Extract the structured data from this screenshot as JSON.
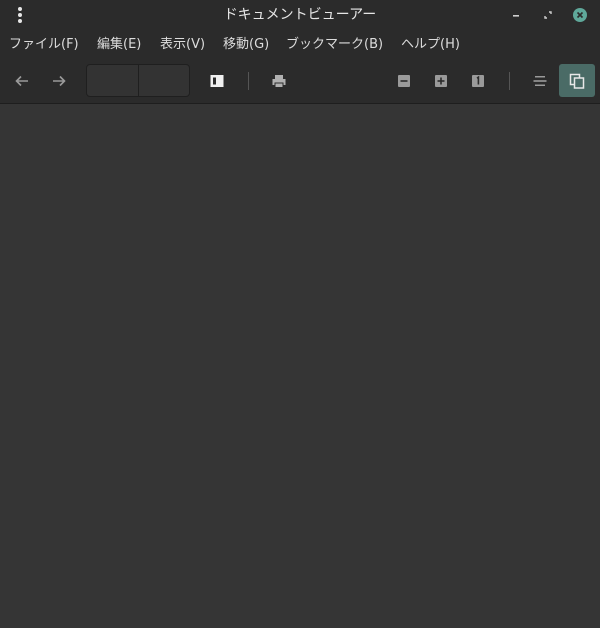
{
  "window": {
    "title": "ドキュメントビューアー",
    "accent_color": "#5fa89a"
  },
  "menubar": {
    "items": [
      {
        "label": "ファイル(F)"
      },
      {
        "label": "編集(E)"
      },
      {
        "label": "表示(V)"
      },
      {
        "label": "移動(G)"
      },
      {
        "label": "ブックマーク(B)"
      },
      {
        "label": "ヘルプ(H)"
      }
    ]
  },
  "toolbar": {
    "page_entry_value": "",
    "page_count_value": "",
    "icons": [
      "back-arrow-icon",
      "forward-arrow-icon",
      "sidebar-icon",
      "print-icon",
      "zoom-out-icon",
      "zoom-in-icon",
      "zoom-reset-icon",
      "dual-page-icon",
      "continuous-icon"
    ]
  }
}
